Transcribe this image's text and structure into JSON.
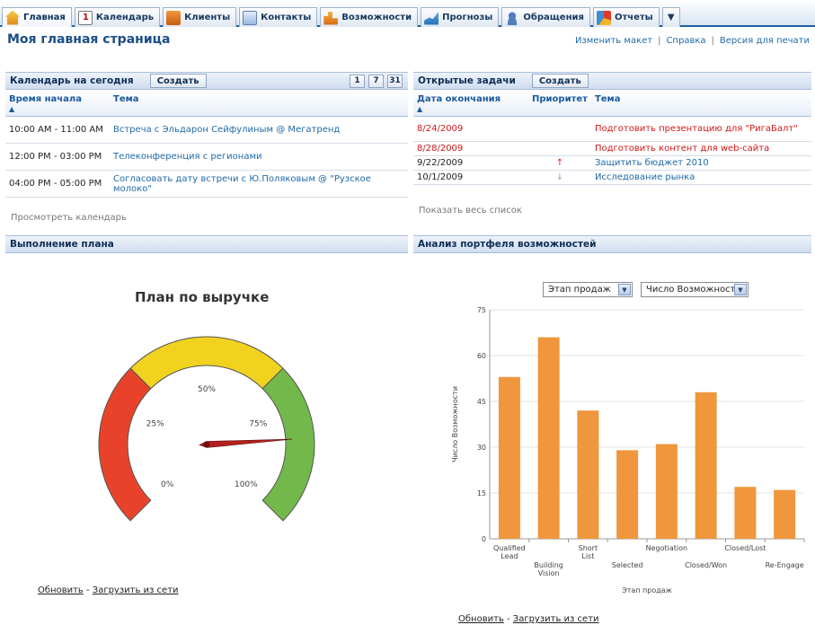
{
  "tabs": [
    {
      "label": "Главная",
      "icon": "home-icon",
      "active": true
    },
    {
      "label": "Календарь",
      "icon": "calendar-icon"
    },
    {
      "label": "Клиенты",
      "icon": "clients-icon"
    },
    {
      "label": "Контакты",
      "icon": "contacts-icon"
    },
    {
      "label": "Возможности",
      "icon": "opportunities-icon"
    },
    {
      "label": "Прогнозы",
      "icon": "forecast-icon"
    },
    {
      "label": "Обращения",
      "icon": "cases-icon"
    },
    {
      "label": "Отчеты",
      "icon": "reports-icon"
    }
  ],
  "page": {
    "title": "Моя главная страница",
    "links": [
      "Изменить макет",
      "Справка",
      "Версия для печати"
    ]
  },
  "calendar": {
    "title": "Календарь на сегодня",
    "create_label": "Создать",
    "view_buttons": [
      "1",
      "7",
      "31"
    ],
    "columns": [
      "Время начала",
      "Тема"
    ],
    "rows": [
      {
        "time": "10:00 AM - 11:00 AM",
        "subject": "Встреча с Эльдарон Сейфулиным @ Мегатренд"
      },
      {
        "time": "12:00 PM - 03:00 PM",
        "subject": "Телеконференция с регионами"
      },
      {
        "time": "04:00 PM - 05:00 PM",
        "subject": "Согласовать дату встречи с Ю.Поляковым @ \"Рузское молоко\""
      }
    ],
    "footer": "Просмотреть календарь"
  },
  "tasks": {
    "title": "Открытые задачи",
    "create_label": "Создать",
    "columns": [
      "Дата окончания",
      "Приоритет",
      "Тема"
    ],
    "rows": [
      {
        "date": "8/24/2009",
        "priority": "",
        "subject": "Подготовить презентацию для \"РигаБалт\"",
        "overdue": true
      },
      {
        "date": "8/28/2009",
        "priority": "",
        "subject": "Подготовить контент для web-сайта",
        "overdue": true
      },
      {
        "date": "9/22/2009",
        "priority": "↑",
        "subject": "Защитить бюджет 2010",
        "overdue": false
      },
      {
        "date": "10/1/2009",
        "priority": "↓",
        "subject": "Исследование рынка",
        "overdue": false
      }
    ],
    "footer": "Показать весь список"
  },
  "plan": {
    "header": "Выполнение плана",
    "gauge_title": "План по выручке",
    "gauge_labels": [
      "0%",
      "25%",
      "50%",
      "75%",
      "100%"
    ],
    "gauge_value_fraction": 0.82,
    "gauge_colors": {
      "low": "#e8432a",
      "mid": "#f1d31f",
      "high": "#73b84a"
    },
    "refresh": "Обновить",
    "dash": " - ",
    "offline": "Загрузить из сети"
  },
  "portfolio": {
    "header": "Анализ портфеля возможностей",
    "select1": "Этап продаж",
    "select2": "Число Возможности",
    "refresh": "Обновить",
    "dash": " - ",
    "offline": "Загрузить из сети"
  },
  "chart_data": {
    "type": "bar",
    "categories": [
      "Qualified Lead",
      "Building Vision",
      "Short List",
      "Selected",
      "Negotiation",
      "Closed/Won",
      "Closed/Lost",
      "Re-Engage"
    ],
    "values": [
      53,
      66,
      42,
      29,
      31,
      48,
      17,
      16
    ],
    "xlabel": "Этап продаж",
    "ylabel": "Число Возможности",
    "ylim": [
      0,
      75
    ],
    "yticks": [
      0,
      15,
      30,
      45,
      60,
      75
    ],
    "bar_color": "#f0963c",
    "grid": true,
    "legend": "none"
  }
}
